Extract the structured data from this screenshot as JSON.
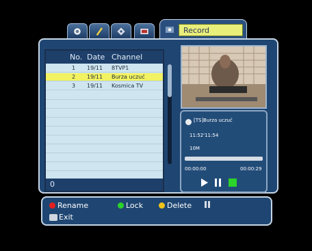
{
  "tabs": [
    {
      "name": "satellite"
    },
    {
      "name": "tools"
    },
    {
      "name": "settings"
    },
    {
      "name": "tv"
    }
  ],
  "active_tab": {
    "label": "Record"
  },
  "list": {
    "headers": {
      "no": "No.",
      "date": "Date",
      "channel": "Channel"
    },
    "rows": [
      {
        "no": "1",
        "date": "19/11",
        "channel": "8TVP1"
      },
      {
        "no": "2",
        "date": "19/11",
        "channel": "Burza uczuć"
      },
      {
        "no": "3",
        "date": "19/11",
        "channel": "Kosmica TV"
      }
    ],
    "footer": "0"
  },
  "info": {
    "title": "[TS]Burza uczuć",
    "time": "11:52'11:54",
    "size": "10M",
    "start": "00:00:00",
    "end": "00:00:29",
    "progress_percent": 0
  },
  "legend": {
    "rename": "Rename",
    "lock": "Lock",
    "delete": "Delete",
    "exit": "Exit"
  },
  "colors": {
    "red": "#e41f1f",
    "green": "#2bd32b",
    "yellow": "#f1c31b"
  }
}
